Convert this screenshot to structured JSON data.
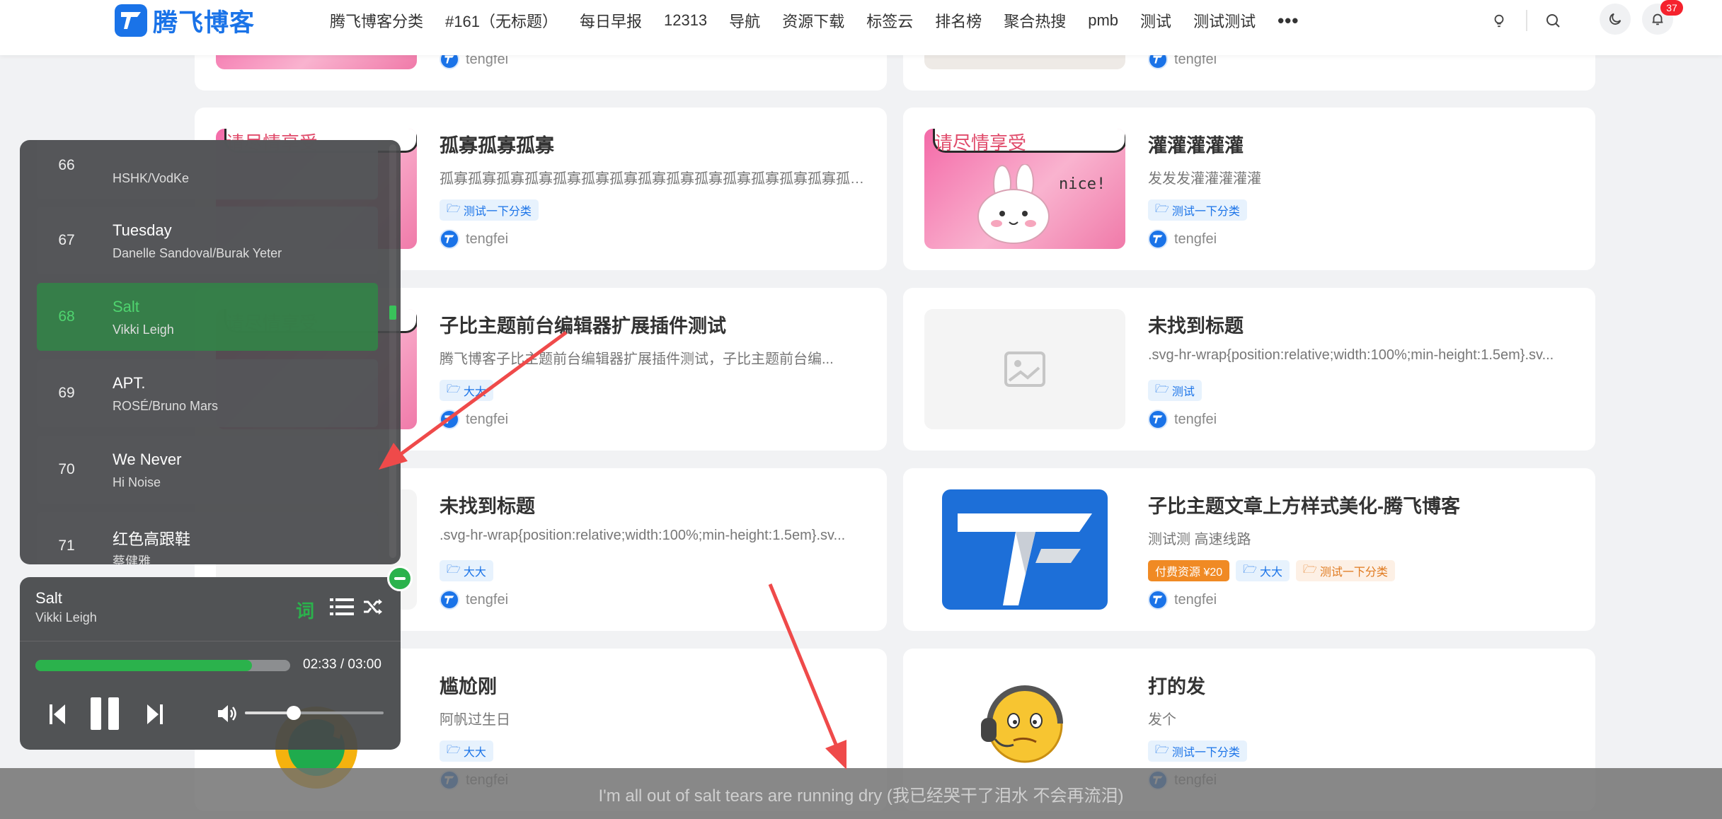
{
  "header": {
    "logo_text": "腾飞博客",
    "nav": [
      "腾飞博客分类",
      "#161（无标题）",
      "每日早报",
      "12313",
      "导航",
      "资源下载",
      "标签云",
      "排名榜",
      "聚合热搜",
      "pmb",
      "测试",
      "测试测试"
    ],
    "more": "•••",
    "notification_count": "37",
    "icons": [
      "bulb-icon",
      "search-icon",
      "moon-icon",
      "bell-icon"
    ]
  },
  "cards": [
    {
      "title": "",
      "desc": "",
      "tags": [],
      "author": "tengfei",
      "thumb": "pink"
    },
    {
      "title": "",
      "desc": "",
      "tags": [],
      "author": "tengfei",
      "thumb": "doc"
    },
    {
      "title": "孤寡孤寡孤寡",
      "desc": "孤寡孤寡孤寡孤寡孤寡孤寡孤寡孤寡孤寡孤寡孤寡孤寡孤寡孤寡孤寡孤寡孤...",
      "tags": [
        {
          "text": "测试一下分类",
          "kind": "blue"
        }
      ],
      "author": "tengfei",
      "thumb": "pink"
    },
    {
      "title": "灌灌灌灌灌",
      "desc": "发发发灌灌灌灌灌",
      "tags": [
        {
          "text": "测试一下分类",
          "kind": "blue"
        }
      ],
      "author": "tengfei",
      "thumb": "pink"
    },
    {
      "title": "子比主题前台编辑器扩展插件测试",
      "desc": "腾飞博客子比主题前台编辑器扩展插件测试，子比主题前台编...",
      "tags": [
        {
          "text": "大大",
          "kind": "blue"
        }
      ],
      "author": "tengfei",
      "thumb": "pink"
    },
    {
      "title": "未找到标题",
      "desc": ".svg-hr-wrap{position:relative;width:100%;min-height:1.5em}.sv...",
      "tags": [
        {
          "text": "测试",
          "kind": "blue"
        }
      ],
      "author": "tengfei",
      "thumb": "gray"
    },
    {
      "title": "未找到标题",
      "desc": ".svg-hr-wrap{position:relative;width:100%;min-height:1.5em}.sv...",
      "tags": [
        {
          "text": "大大",
          "kind": "blue"
        }
      ],
      "author": "tengfei",
      "thumb": "gray"
    },
    {
      "title": "子比主题文章上方样式美化-腾飞博客",
      "desc": "测试测 高速线路",
      "tags": [
        {
          "text": "付费资源 ¥20",
          "kind": "paid"
        },
        {
          "text": "大大",
          "kind": "blue"
        },
        {
          "text": "测试一下分类",
          "kind": "orange"
        }
      ],
      "author": "tengfei",
      "thumb": "logo"
    },
    {
      "title": "尴尬刚",
      "desc": "阿帆过生日",
      "tags": [
        {
          "text": "大大",
          "kind": "blue"
        }
      ],
      "author": "tengfei",
      "thumb": "qq"
    },
    {
      "title": "打的发",
      "desc": "发个",
      "tags": [
        {
          "text": "测试一下分类",
          "kind": "blue"
        }
      ],
      "author": "tengfei",
      "thumb": "emoji"
    }
  ],
  "thumb_text": {
    "bubble": "请尽情享受",
    "nice": "nice!"
  },
  "playlist": [
    {
      "num": "66",
      "name": "",
      "artist": "HSHK/VodKe"
    },
    {
      "num": "67",
      "name": "Tuesday",
      "artist": "Danelle Sandoval/Burak Yeter"
    },
    {
      "num": "68",
      "name": "Salt",
      "artist": "Vikki Leigh",
      "active": true
    },
    {
      "num": "69",
      "name": "APT.",
      "artist": "ROSÉ/Bruno Mars"
    },
    {
      "num": "70",
      "name": "We Never",
      "artist": "Hi Noise"
    },
    {
      "num": "71",
      "name": "红色高跟鞋",
      "artist": "蔡健雅"
    }
  ],
  "player": {
    "title": "Salt",
    "artist": "Vikki Leigh",
    "lyric_button": "词",
    "current_time": "02:33",
    "total_time": "03:00",
    "progress": 0.85,
    "volume": 0.35
  },
  "lyric_line": "I'm all out of salt tears are running dry (我已经哭干了泪水 不会再流泪)",
  "colors": {
    "brand": "#1a73e8",
    "player_green": "#2bb24c",
    "badge_red": "#f5222d",
    "arrow_red": "#ef4a4a"
  }
}
